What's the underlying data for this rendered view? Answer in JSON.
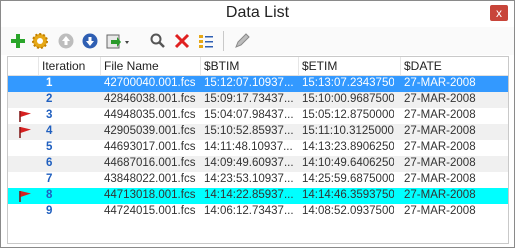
{
  "window": {
    "title": "Data List",
    "close_label": "x"
  },
  "toolbar": {
    "items": [
      {
        "name": "add-icon"
      },
      {
        "name": "gear-icon"
      },
      {
        "name": "up-icon"
      },
      {
        "name": "down-icon"
      },
      {
        "name": "export-icon"
      },
      {
        "name": "search-icon"
      },
      {
        "name": "delete-icon"
      },
      {
        "name": "list-icon"
      },
      {
        "name": "edit-icon"
      }
    ]
  },
  "table": {
    "headers": [
      "Iteration",
      "File Name",
      "$BTIM",
      "$ETIM",
      "$DATE"
    ],
    "rows": [
      {
        "iter": "1",
        "file": "42700040.001.fcs",
        "btim": "15:12:07.10937...",
        "etim": "15:13:07.2343750",
        "date": "27-MAR-2008",
        "flag": false,
        "state": "selected"
      },
      {
        "iter": "2",
        "file": "42846038.001.fcs",
        "btim": "15:09:17.73437...",
        "etim": "15:10:00.9687500",
        "date": "27-MAR-2008",
        "flag": false,
        "state": "alt"
      },
      {
        "iter": "3",
        "file": "44948035.001.fcs",
        "btim": "15:04:07.98437...",
        "etim": "15:05:12.8750000",
        "date": "27-MAR-2008",
        "flag": true,
        "state": ""
      },
      {
        "iter": "4",
        "file": "42905039.001.fcs",
        "btim": "15:10:52.85937...",
        "etim": "15:11:10.3125000",
        "date": "27-MAR-2008",
        "flag": true,
        "state": "alt"
      },
      {
        "iter": "5",
        "file": "44693017.001.fcs",
        "btim": "14:11:48.10937...",
        "etim": "14:13:23.8906250",
        "date": "27-MAR-2008",
        "flag": false,
        "state": ""
      },
      {
        "iter": "6",
        "file": "44687016.001.fcs",
        "btim": "14:09:49.60937...",
        "etim": "14:10:49.6406250",
        "date": "27-MAR-2008",
        "flag": false,
        "state": "alt"
      },
      {
        "iter": "7",
        "file": "43848022.001.fcs",
        "btim": "14:23:53.10937...",
        "etim": "14:25:59.6875000",
        "date": "27-MAR-2008",
        "flag": false,
        "state": ""
      },
      {
        "iter": "8",
        "file": "44713018.001.fcs",
        "btim": "14:14:22.85937...",
        "etim": "14:14:46.3593750",
        "date": "27-MAR-2008",
        "flag": true,
        "state": "cyan"
      },
      {
        "iter": "9",
        "file": "44724015.001.fcs",
        "btim": "14:06:12.73437...",
        "etim": "14:08:52.0937500",
        "date": "27-MAR-2008",
        "flag": false,
        "state": ""
      }
    ]
  },
  "colors": {
    "selected": "#3399ff",
    "highlight": "#00ffff",
    "iteration_text": "#1f5fbf",
    "flag": "#d62020"
  }
}
